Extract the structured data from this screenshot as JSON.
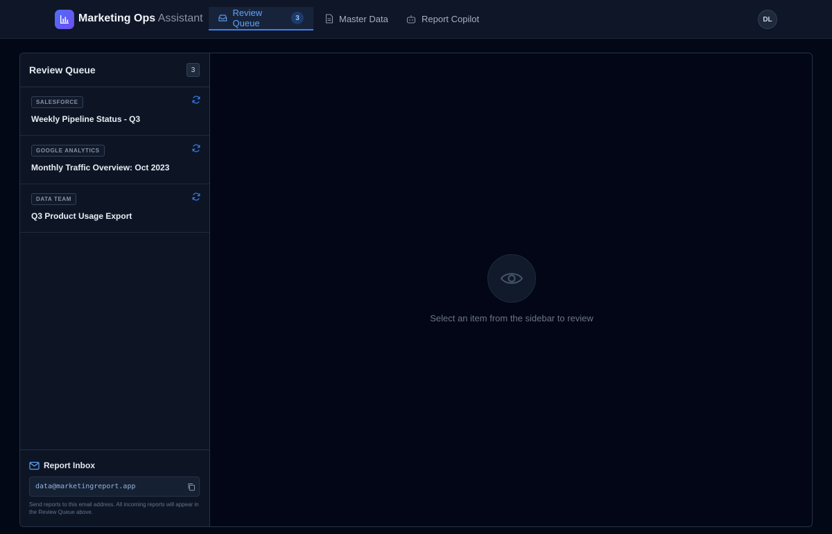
{
  "app": {
    "name_strong": "Marketing Ops",
    "name_light": "Assistant",
    "brand_color": "#5b5ef4",
    "accent_color": "#3b82f6"
  },
  "nav": {
    "tabs": [
      {
        "label": "Review Queue",
        "icon": "inbox-icon",
        "badge": "3",
        "active": true
      },
      {
        "label": "Master Data",
        "icon": "document-icon",
        "active": false
      },
      {
        "label": "Report Copilot",
        "icon": "bot-icon",
        "active": false
      }
    ],
    "user_initials": "DL"
  },
  "sidebar": {
    "title": "Review Queue",
    "count": "3",
    "items": [
      {
        "source": "SALESFORCE",
        "title": "Weekly Pipeline Status - Q3",
        "icon": "refresh-icon"
      },
      {
        "source": "GOOGLE ANALYTICS",
        "title": "Monthly Traffic Overview: Oct 2023",
        "icon": "refresh-icon"
      },
      {
        "source": "DATA TEAM",
        "title": "Q3 Product Usage Export",
        "icon": "refresh-icon"
      }
    ]
  },
  "inbox": {
    "title": "Report Inbox",
    "email": "data@marketingreport.app",
    "help_text": "Send reports to this email address. All incoming reports will appear in the Review Queue above."
  },
  "main": {
    "empty_icon": "eye-icon",
    "empty_message": "Select an item from the sidebar to review"
  }
}
